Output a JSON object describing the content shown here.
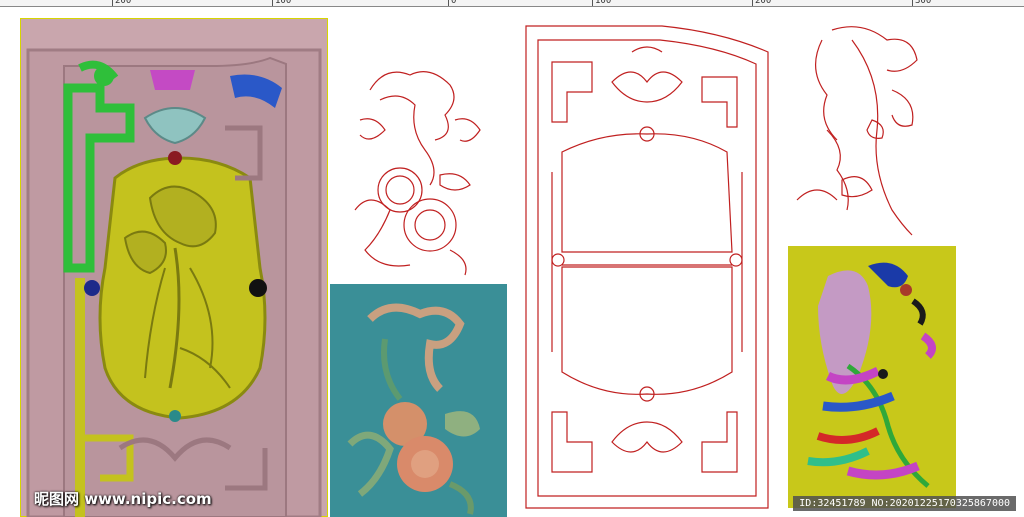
{
  "ruler": {
    "labels": [
      "200",
      "100",
      "0",
      "100",
      "200",
      "300"
    ]
  },
  "watermark": {
    "text": "昵图网 www.nipic.com"
  },
  "image_id": {
    "text": "ID:32451789 NO:20201225170325867000"
  },
  "colors": {
    "relief_pink": "#c9a6ad",
    "relief_yellow": "#c4c21e",
    "relief_green": "#2fbf3a",
    "teal_bg": "#3a8f97",
    "line_red": "#c02020",
    "yellow_bg": "#c8c81a"
  }
}
